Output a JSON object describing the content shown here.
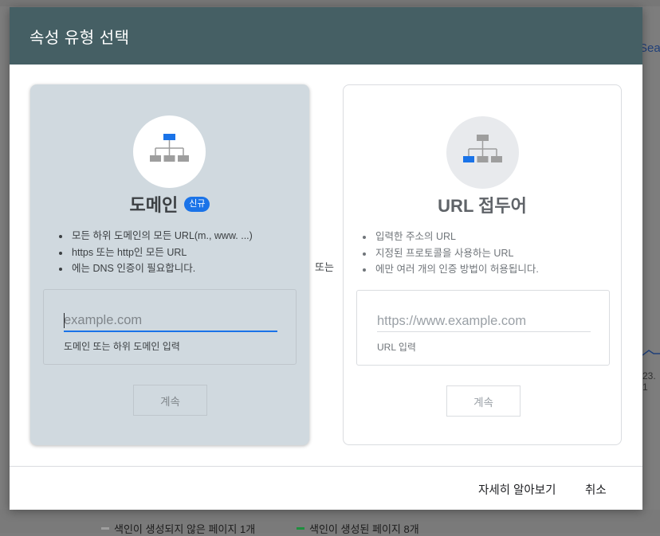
{
  "background": {
    "right_link": "Sea",
    "right_date": "23. 1",
    "legend": [
      {
        "label": "색인이 생성되지 않은 페이지 1개",
        "color": "#9e9e9e"
      },
      {
        "label": "색인이 생성된 페이지 8개",
        "color": "#1e8e3e"
      }
    ]
  },
  "dialog": {
    "title": "속성 유형 선택",
    "or_label": "또는",
    "domain": {
      "title": "도메인",
      "badge": "신규",
      "icon": "sitemap-icon-domain",
      "bullets": [
        "모든 하위 도메인의 모든 URL(m., www. ...)",
        "https 또는 http인 모든 URL",
        "에는 DNS 인증이 필요합니다."
      ],
      "input_placeholder": "example.com",
      "input_value": "",
      "input_help": "도메인 또는 하위 도메인 입력",
      "continue_label": "계속"
    },
    "url_prefix": {
      "title": "URL 접두어",
      "icon": "sitemap-icon-url-prefix",
      "bullets": [
        "입력한 주소의 URL",
        "지정된 프로토콜을 사용하는 URL",
        "에만 여러 개의 인증 방법이 허용됩니다."
      ],
      "input_placeholder": "https://www.example.com",
      "input_value": "",
      "input_help": "URL 입력",
      "continue_label": "계속"
    },
    "footer": {
      "learn_more": "자세히 알아보기",
      "cancel": "취소"
    }
  },
  "colors": {
    "header": "#455f64",
    "accent": "#1a73e8",
    "domain_card": "#d0d9df"
  }
}
